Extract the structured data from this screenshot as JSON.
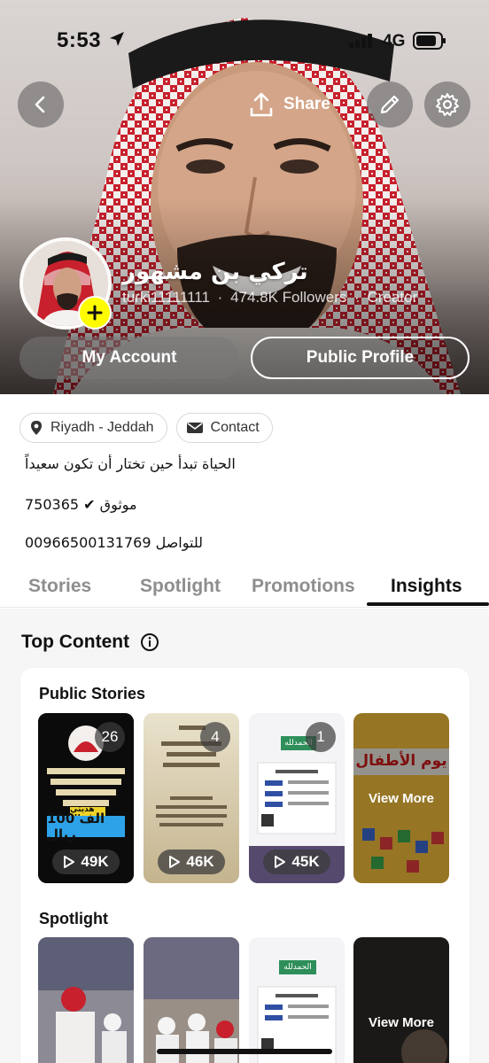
{
  "status_bar": {
    "time": "5:53",
    "network": "4G"
  },
  "header": {
    "share_label": "Share",
    "display_name": "تركي بن مشهور",
    "username": "turki11111111",
    "followers": "474.8K Followers",
    "role": "Creator",
    "separator": "·",
    "my_account_label": "My Account",
    "public_profile_label": "Public Profile"
  },
  "info": {
    "location": "Riyadh - Jeddah",
    "contact_label": "Contact",
    "bio_lines": [
      "الحياة تبدأ حين تختار أن تكون سعيداً",
      "موثوق ✔ 750365",
      "للتواصل 00966500131769"
    ]
  },
  "tabs": [
    {
      "label": "Stories",
      "active": false
    },
    {
      "label": "Spotlight",
      "active": false
    },
    {
      "label": "Promotions",
      "active": false
    },
    {
      "label": "Insights",
      "active": true
    }
  ],
  "insights": {
    "title": "Top Content",
    "public_stories": {
      "title": "Public Stories",
      "items": [
        {
          "count": "26",
          "views": "49K",
          "prize_text": "100 الف ريال",
          "banner_text": "هديتي لك"
        },
        {
          "count": "4",
          "views": "46K"
        },
        {
          "count": "1",
          "views": "45K",
          "tag_text": "الحمدلله"
        },
        {
          "view_more": "View More",
          "caption": "يوم الأطفال"
        }
      ]
    },
    "spotlight": {
      "title": "Spotlight",
      "items": [
        {},
        {},
        {
          "tag_text": "الحمدلله"
        },
        {
          "view_more": "View More"
        }
      ]
    }
  },
  "colors": {
    "snap_yellow": "#fffc00",
    "active_tab": "#111111",
    "inactive_tab": "#8e8e8e"
  }
}
